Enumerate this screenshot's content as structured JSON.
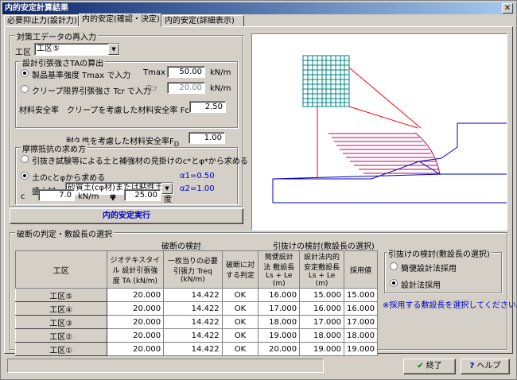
{
  "window": {
    "title": "内的安定計算結果"
  },
  "tabs": [
    "必要抑止力(設計力)",
    "内的安定(確認・決定)",
    "内的安定(詳細表示)"
  ],
  "conditions": {
    "group_title": "対策工データの再入力",
    "area_label": "工区",
    "area_value": "工区⑤",
    "ta_group_title": "設計引張強さTAの算出",
    "product_label": "製品基準強度 Tmax で入力",
    "tmax_label": "Tmax",
    "tmax_value": "50.00",
    "unit_kn_m": "kN/m",
    "creep_label": "クリープ限界引張強さ Tcr で入力",
    "tcr_label": "Tcr",
    "tcr_value": "20.00",
    "safety_label": "材料安全率",
    "creep_factor_label": "クリープを考慮した材料安全率 Fcr",
    "fcr_value": "2.50",
    "durability_label": "耐久性を考慮した材料安全率F",
    "durability_sub": "D",
    "fd_value": "1.00"
  },
  "friction": {
    "group_title": "摩擦抵抗の求め方",
    "option1_label": "引抜き試験等による土と補強材の見掛けのc*とφ*から求める",
    "option2_label": "土のcとφから求める",
    "fill_label": "盛土材",
    "fill_value": "砂質土(cφ材)または粘性土",
    "alpha1": "α1=0.50",
    "alpha2": "α2=1.00",
    "c_label": "c",
    "c_value": "7.0",
    "c_unit": "kN/m",
    "phi_label": "φ",
    "phi_value": "25.00",
    "phi_unit": "度"
  },
  "run_button": "内的安定実行",
  "results": {
    "group_title": "破断の判定・敷設長の選択",
    "break_check_header": "破断の検討",
    "pull_check_header": "引抜けの検討(敷設長の選択)",
    "columns": [
      "工区",
      "ジオテキスタイル 設計引張強度 TA (kN/m)",
      "一枚当りの必要引張力 Treq (kN/m)",
      "破断に対する判定",
      "簡便設計法 敷設長 Ls + Le (m)",
      "設計法内的 安定敷設長 Ls + Le (m)",
      "採用値"
    ],
    "rows": [
      {
        "area": "工区⑤",
        "ta": "20.000",
        "treq": "14.422",
        "judge": "OK",
        "simple": "16.000",
        "design": "15.000",
        "adopt": "15.000"
      },
      {
        "area": "工区④",
        "ta": "20.000",
        "treq": "14.422",
        "judge": "OK",
        "simple": "17.000",
        "design": "16.000",
        "adopt": "16.000"
      },
      {
        "area": "工区③",
        "ta": "20.000",
        "treq": "14.422",
        "judge": "OK",
        "simple": "18.000",
        "design": "17.000",
        "adopt": "17.000"
      },
      {
        "area": "工区②",
        "ta": "20.000",
        "treq": "14.422",
        "judge": "OK",
        "simple": "19.000",
        "design": "18.000",
        "adopt": "18.000"
      },
      {
        "area": "工区①",
        "ta": "20.000",
        "treq": "14.422",
        "judge": "OK",
        "simple": "20.000",
        "design": "19.000",
        "adopt": "19.000"
      }
    ]
  },
  "pullout": {
    "group_title": "引抜けの検討(敷設長の選択)",
    "option1_label": "簡便設計法採用",
    "option2_label": "設計法採用",
    "note": "※採用する敷設長を選択してください。"
  },
  "footer": {
    "ok_label": "終了",
    "help_label": "ヘルプ"
  },
  "colors": {
    "accent_blue": "#0000c0",
    "slope_red": "#ff0000",
    "grid_teal": "#008080",
    "hatch_magenta": "#c00060"
  }
}
